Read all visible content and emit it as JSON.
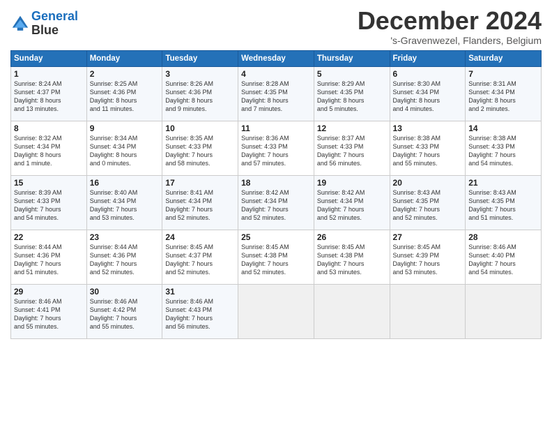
{
  "header": {
    "logo_line1": "General",
    "logo_line2": "Blue",
    "month": "December 2024",
    "location": "'s-Gravenwezel, Flanders, Belgium"
  },
  "days_of_week": [
    "Sunday",
    "Monday",
    "Tuesday",
    "Wednesday",
    "Thursday",
    "Friday",
    "Saturday"
  ],
  "weeks": [
    [
      {
        "day": "1",
        "lines": [
          "Sunrise: 8:24 AM",
          "Sunset: 4:37 PM",
          "Daylight: 8 hours",
          "and 13 minutes."
        ]
      },
      {
        "day": "2",
        "lines": [
          "Sunrise: 8:25 AM",
          "Sunset: 4:36 PM",
          "Daylight: 8 hours",
          "and 11 minutes."
        ]
      },
      {
        "day": "3",
        "lines": [
          "Sunrise: 8:26 AM",
          "Sunset: 4:36 PM",
          "Daylight: 8 hours",
          "and 9 minutes."
        ]
      },
      {
        "day": "4",
        "lines": [
          "Sunrise: 8:28 AM",
          "Sunset: 4:35 PM",
          "Daylight: 8 hours",
          "and 7 minutes."
        ]
      },
      {
        "day": "5",
        "lines": [
          "Sunrise: 8:29 AM",
          "Sunset: 4:35 PM",
          "Daylight: 8 hours",
          "and 5 minutes."
        ]
      },
      {
        "day": "6",
        "lines": [
          "Sunrise: 8:30 AM",
          "Sunset: 4:34 PM",
          "Daylight: 8 hours",
          "and 4 minutes."
        ]
      },
      {
        "day": "7",
        "lines": [
          "Sunrise: 8:31 AM",
          "Sunset: 4:34 PM",
          "Daylight: 8 hours",
          "and 2 minutes."
        ]
      }
    ],
    [
      {
        "day": "8",
        "lines": [
          "Sunrise: 8:32 AM",
          "Sunset: 4:34 PM",
          "Daylight: 8 hours",
          "and 1 minute."
        ]
      },
      {
        "day": "9",
        "lines": [
          "Sunrise: 8:34 AM",
          "Sunset: 4:34 PM",
          "Daylight: 8 hours",
          "and 0 minutes."
        ]
      },
      {
        "day": "10",
        "lines": [
          "Sunrise: 8:35 AM",
          "Sunset: 4:33 PM",
          "Daylight: 7 hours",
          "and 58 minutes."
        ]
      },
      {
        "day": "11",
        "lines": [
          "Sunrise: 8:36 AM",
          "Sunset: 4:33 PM",
          "Daylight: 7 hours",
          "and 57 minutes."
        ]
      },
      {
        "day": "12",
        "lines": [
          "Sunrise: 8:37 AM",
          "Sunset: 4:33 PM",
          "Daylight: 7 hours",
          "and 56 minutes."
        ]
      },
      {
        "day": "13",
        "lines": [
          "Sunrise: 8:38 AM",
          "Sunset: 4:33 PM",
          "Daylight: 7 hours",
          "and 55 minutes."
        ]
      },
      {
        "day": "14",
        "lines": [
          "Sunrise: 8:38 AM",
          "Sunset: 4:33 PM",
          "Daylight: 7 hours",
          "and 54 minutes."
        ]
      }
    ],
    [
      {
        "day": "15",
        "lines": [
          "Sunrise: 8:39 AM",
          "Sunset: 4:33 PM",
          "Daylight: 7 hours",
          "and 54 minutes."
        ]
      },
      {
        "day": "16",
        "lines": [
          "Sunrise: 8:40 AM",
          "Sunset: 4:34 PM",
          "Daylight: 7 hours",
          "and 53 minutes."
        ]
      },
      {
        "day": "17",
        "lines": [
          "Sunrise: 8:41 AM",
          "Sunset: 4:34 PM",
          "Daylight: 7 hours",
          "and 52 minutes."
        ]
      },
      {
        "day": "18",
        "lines": [
          "Sunrise: 8:42 AM",
          "Sunset: 4:34 PM",
          "Daylight: 7 hours",
          "and 52 minutes."
        ]
      },
      {
        "day": "19",
        "lines": [
          "Sunrise: 8:42 AM",
          "Sunset: 4:34 PM",
          "Daylight: 7 hours",
          "and 52 minutes."
        ]
      },
      {
        "day": "20",
        "lines": [
          "Sunrise: 8:43 AM",
          "Sunset: 4:35 PM",
          "Daylight: 7 hours",
          "and 52 minutes."
        ]
      },
      {
        "day": "21",
        "lines": [
          "Sunrise: 8:43 AM",
          "Sunset: 4:35 PM",
          "Daylight: 7 hours",
          "and 51 minutes."
        ]
      }
    ],
    [
      {
        "day": "22",
        "lines": [
          "Sunrise: 8:44 AM",
          "Sunset: 4:36 PM",
          "Daylight: 7 hours",
          "and 51 minutes."
        ]
      },
      {
        "day": "23",
        "lines": [
          "Sunrise: 8:44 AM",
          "Sunset: 4:36 PM",
          "Daylight: 7 hours",
          "and 52 minutes."
        ]
      },
      {
        "day": "24",
        "lines": [
          "Sunrise: 8:45 AM",
          "Sunset: 4:37 PM",
          "Daylight: 7 hours",
          "and 52 minutes."
        ]
      },
      {
        "day": "25",
        "lines": [
          "Sunrise: 8:45 AM",
          "Sunset: 4:38 PM",
          "Daylight: 7 hours",
          "and 52 minutes."
        ]
      },
      {
        "day": "26",
        "lines": [
          "Sunrise: 8:45 AM",
          "Sunset: 4:38 PM",
          "Daylight: 7 hours",
          "and 53 minutes."
        ]
      },
      {
        "day": "27",
        "lines": [
          "Sunrise: 8:45 AM",
          "Sunset: 4:39 PM",
          "Daylight: 7 hours",
          "and 53 minutes."
        ]
      },
      {
        "day": "28",
        "lines": [
          "Sunrise: 8:46 AM",
          "Sunset: 4:40 PM",
          "Daylight: 7 hours",
          "and 54 minutes."
        ]
      }
    ],
    [
      {
        "day": "29",
        "lines": [
          "Sunrise: 8:46 AM",
          "Sunset: 4:41 PM",
          "Daylight: 7 hours",
          "and 55 minutes."
        ]
      },
      {
        "day": "30",
        "lines": [
          "Sunrise: 8:46 AM",
          "Sunset: 4:42 PM",
          "Daylight: 7 hours",
          "and 55 minutes."
        ]
      },
      {
        "day": "31",
        "lines": [
          "Sunrise: 8:46 AM",
          "Sunset: 4:43 PM",
          "Daylight: 7 hours",
          "and 56 minutes."
        ]
      },
      {
        "day": "",
        "lines": []
      },
      {
        "day": "",
        "lines": []
      },
      {
        "day": "",
        "lines": []
      },
      {
        "day": "",
        "lines": []
      }
    ]
  ]
}
